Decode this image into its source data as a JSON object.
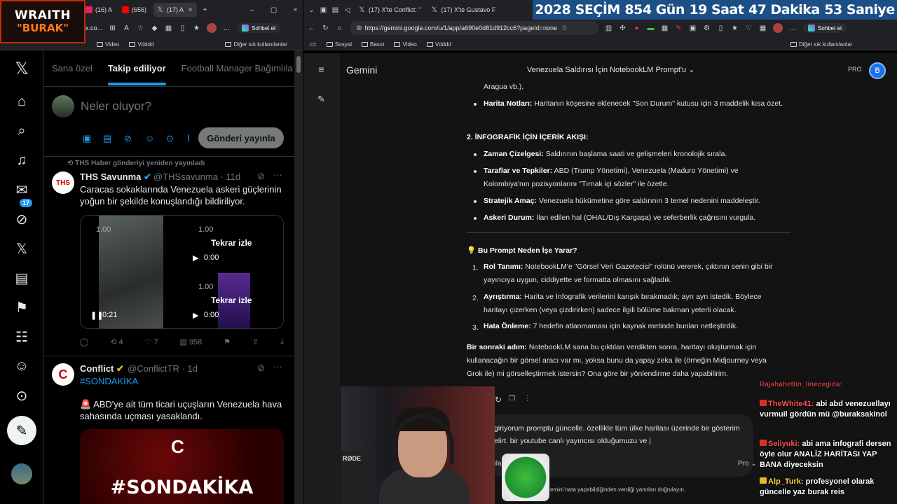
{
  "overlay": {
    "logo_line1": "WRAITH",
    "logo_line2": "\"BURAK\"",
    "countdown": [
      "2028",
      "SEÇİM",
      "854 Gün",
      "19 Saat",
      "47 Dakika",
      "53 Saniye"
    ]
  },
  "left_browser": {
    "tabs": [
      "(16) A",
      "(656)",
      "(17) A"
    ],
    "new_tab": "+",
    "url": "x.co...",
    "sohbet": "Sohbet et",
    "bookmarks": [
      "Video",
      "Vdddd"
    ],
    "other_bookmarks": "Diğer sık kullanılanlar"
  },
  "right_browser": {
    "tabs": [
      "(17) X'te Conflict: \"",
      "(17) X'te Gustavo F"
    ],
    "url": "https://gemini.google.com/u/1/app/a690e0d81d912cc6?pageId=none",
    "sohbet": "Sohbet et",
    "bookmarks": [
      "Sosyal",
      "Basın",
      "Video",
      "Vdddd"
    ],
    "other_bookmarks": "Diğer sık kullanılanlar"
  },
  "twitter": {
    "notif_count": "17",
    "tabs": [
      "Sana özel",
      "Takip ediliyor",
      "Football Manager Bağımlıla"
    ],
    "compose_placeholder": "Neler oluyor?",
    "post_button": "Gönderi yayınla",
    "retweet_note": "THS Haber gönderiyi yeniden yayınladı",
    "tweet1": {
      "name": "THS Savunma",
      "handle": "@THSsavunma · 11d",
      "text": "Caracas sokaklarında Venezuela askeri güçlerinin yoğun bir şekilde konuşlandığı bildiriliyor.",
      "speed1": "1.00",
      "speed2": "1.00",
      "speed3": "1.00",
      "replay": "Tekrar izle",
      "time_a": "0:00",
      "time_b": "0:00",
      "time_main": "0:21",
      "retweets": "4",
      "likes": "7",
      "views": "958"
    },
    "tweet2": {
      "name": "Conflict",
      "handle": "@ConflictTR · 1d",
      "hashtag": "#SONDAKİKA",
      "text": "🚨 ABD'ye ait tüm ticari uçuşların Venezuela hava sahasında uçması yasaklandı.",
      "image_text": "#SONDAKİKA",
      "image_logo": "C"
    }
  },
  "gemini": {
    "title": "Gemini",
    "chat_title": "Venezuela Saldırısı İçin NotebookLM Prompt'u",
    "pro": "PRO",
    "avatar": "B",
    "top_fragment": "Aragua vb.).",
    "harita_label": "Harita Notları:",
    "harita_text": "Haritanın köşesine eklenecek \"Son Durum\" kutusu için 3 maddelik kısa özet.",
    "section2": "2. İNFOGRAFİK İÇİN İÇERİK AKIŞI:",
    "bullets": [
      {
        "label": "Zaman Çizelgesi:",
        "text": "Saldırının başlama saati ve gelişmeleri kronolojik sırala."
      },
      {
        "label": "Taraflar ve Tepkiler:",
        "text": "ABD (Trump Yönetimi), Venezuela (Maduro Yönetimi) ve Kolombiya'nın pozisyonlarını \"Tırnak içi sözler\" ile özetle."
      },
      {
        "label": "Stratejik Amaç:",
        "text": "Venezuela hükümetine göre saldırının 3 temel nedenini maddeleştir."
      },
      {
        "label": "Askeri Durum:",
        "text": "İlan edilen hal (OHAL/Dış Kargaşa) ve seferberlik çağrısını vurgula."
      }
    ],
    "why_heading": "💡 Bu Prompt Neden İşe Yarar?",
    "numbered": [
      {
        "label": "Rol Tanımı:",
        "text": "NotebookLM'e \"Görsel Veri Gazetecisi\" rolünü vererek, çıktının senin gibi bir yayıncıya uygun, ciddiyette ve formatta olmasını sağladık."
      },
      {
        "label": "Ayrıştırma:",
        "text": "Harita ve İnfografik verilerini karışık bırakmadık; ayrı ayrı istedik. Böylece haritayı çizerken (veya çizdirirken) sadece ilgili bölüme bakman yeterli olacak."
      },
      {
        "label": "Hata Önleme:",
        "text": "7 hedefin atlanmaması için kaynak metinde bunları netleştirdik."
      }
    ],
    "next_label": "Bir sonraki adım:",
    "next_text": "NotebookLM sana bu çıktıları verdikten sonra, haritayı oluşturmak için kullanacağın bir görsel aracı var mı, yoksa bunu da yapay zeka ile (örneğin Midjourney veya Grok ile) mi görselleştirmek istersin? Ona göre bir yönlendirme daha yapabilirim.",
    "input_line1": "giriyorum promptu güncelle. özellikle tüm ülke haritası üzerinde bir gösterim",
    "input_line2": "elirt. bir youtube canlı yayıncısı olduğumuzu ve |",
    "input_tool": "ıla",
    "model": "Pro",
    "disclaimer": "emini hata yapabildiğinden verdiği yanıtları doğrulayın."
  },
  "stream": {
    "mic_brand": "RØDE",
    "chat": [
      {
        "user": "TheWhite41:",
        "text": "abi abd venezuellayı vurmuil gördün mü @buraksakinol"
      },
      {
        "user": "Seliyuki:",
        "text": "abi ama infografi dersen öyle olur ANALİZ HARİTASI YAP BANA diyeceksin"
      },
      {
        "user": "Alp_Turk:",
        "text": "profesyonel olarak güncelle yaz burak reis"
      }
    ],
    "chat_partial": "Rajahahettin_linecegida:"
  }
}
